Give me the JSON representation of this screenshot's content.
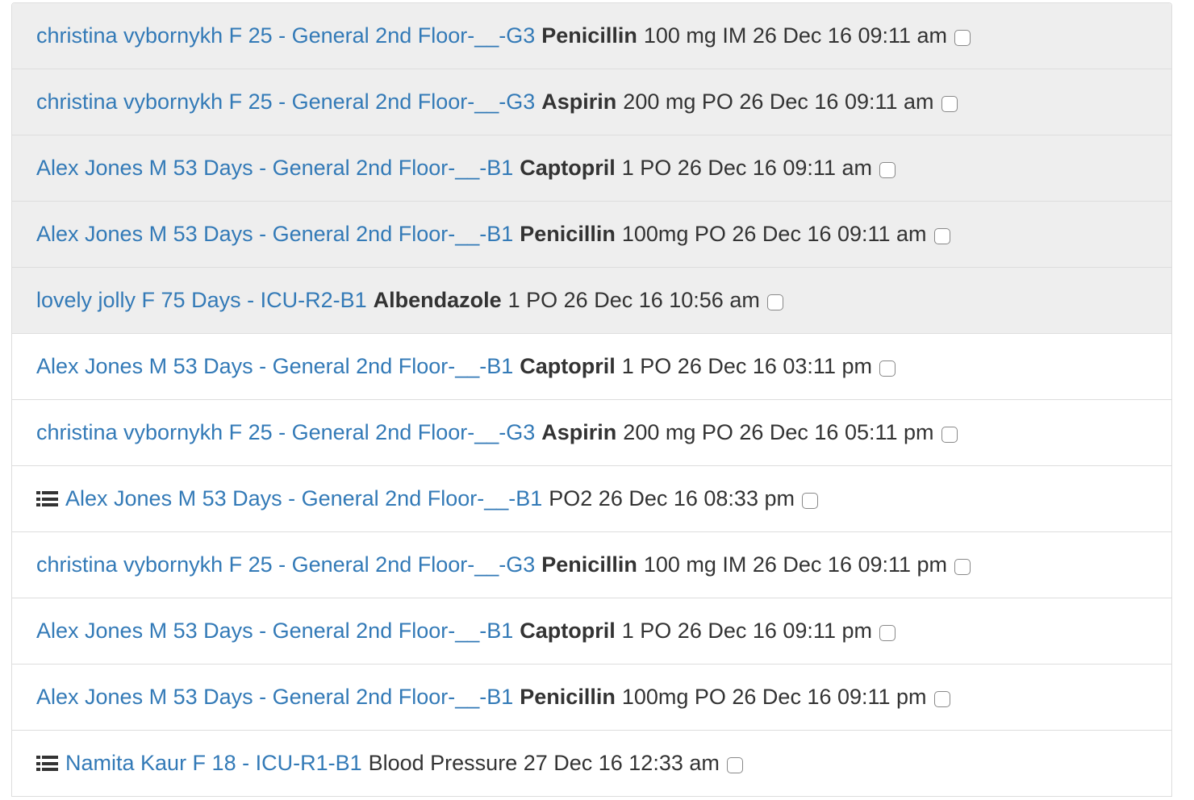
{
  "rows": [
    {
      "done": true,
      "icon": null,
      "patient": "christina vybornykh F 25 - General 2nd Floor-__-G3",
      "drug": "Penicillin",
      "detail": "100 mg IM 26 Dec 16 09:11 am"
    },
    {
      "done": true,
      "icon": null,
      "patient": "christina vybornykh F 25 - General 2nd Floor-__-G3",
      "drug": "Aspirin",
      "detail": "200 mg PO 26 Dec 16 09:11 am"
    },
    {
      "done": true,
      "icon": null,
      "patient": "Alex Jones M 53 Days - General 2nd Floor-__-B1",
      "drug": "Captopril",
      "detail": "1 PO 26 Dec 16 09:11 am"
    },
    {
      "done": true,
      "icon": null,
      "patient": "Alex Jones M 53 Days - General 2nd Floor-__-B1",
      "drug": "Penicillin",
      "detail": "100mg PO 26 Dec 16 09:11 am"
    },
    {
      "done": true,
      "icon": null,
      "patient": "lovely jolly F 75 Days - ICU-R2-B1",
      "drug": "Albendazole",
      "detail": "1 PO 26 Dec 16 10:56 am"
    },
    {
      "done": false,
      "icon": null,
      "patient": "Alex Jones M 53 Days - General 2nd Floor-__-B1",
      "drug": "Captopril",
      "detail": "1 PO 26 Dec 16 03:11 pm"
    },
    {
      "done": false,
      "icon": null,
      "patient": "christina vybornykh F 25 - General 2nd Floor-__-G3",
      "drug": "Aspirin",
      "detail": "200 mg PO 26 Dec 16 05:11 pm"
    },
    {
      "done": false,
      "icon": "list-icon",
      "patient": "Alex Jones M 53 Days - General 2nd Floor-__-B1",
      "drug": "",
      "detail": "PO2 26 Dec 16 08:33 pm"
    },
    {
      "done": false,
      "icon": null,
      "patient": "christina vybornykh F 25 - General 2nd Floor-__-G3",
      "drug": "Penicillin",
      "detail": "100 mg IM 26 Dec 16 09:11 pm"
    },
    {
      "done": false,
      "icon": null,
      "patient": "Alex Jones M 53 Days - General 2nd Floor-__-B1",
      "drug": "Captopril",
      "detail": "1 PO 26 Dec 16 09:11 pm"
    },
    {
      "done": false,
      "icon": null,
      "patient": "Alex Jones M 53 Days - General 2nd Floor-__-B1",
      "drug": "Penicillin",
      "detail": "100mg PO 26 Dec 16 09:11 pm"
    },
    {
      "done": false,
      "icon": "list-icon",
      "patient": "Namita Kaur F 18 - ICU-R1-B1",
      "drug": "",
      "detail": "Blood Pressure 27 Dec 16 12:33 am"
    }
  ],
  "colors": {
    "link": "#337ab7",
    "done_row_bg": "#eeeeee",
    "text": "#333333",
    "border": "#dddddd"
  }
}
